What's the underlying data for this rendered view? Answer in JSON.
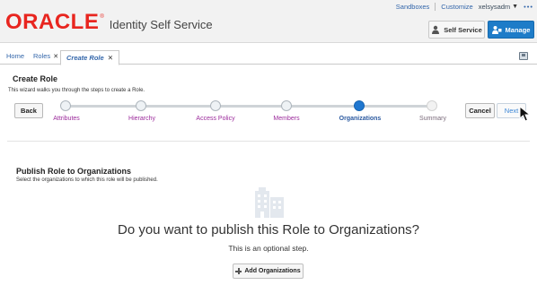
{
  "header": {
    "brand": "ORACLE",
    "product": "Identity Self Service",
    "links": {
      "sandboxes": "Sandboxes",
      "customize": "Customize",
      "user": "xelsysadm"
    },
    "self_service_label": "Self Service",
    "manage_label": "Manage",
    "accent_color": "#1e7cc8",
    "brand_color": "#e8251f"
  },
  "tabs": [
    {
      "label": "Home",
      "closable": false
    },
    {
      "label": "Roles",
      "closable": true
    },
    {
      "label": "Create Role",
      "closable": true,
      "active": true
    }
  ],
  "wizard": {
    "title": "Create Role",
    "description": "This wizard walks you through the steps to create a Role.",
    "back_label": "Back",
    "cancel_label": "Cancel",
    "next_label": "Next",
    "steps": [
      {
        "label": "Attributes",
        "state": "visited"
      },
      {
        "label": "Hierarchy",
        "state": "visited"
      },
      {
        "label": "Access Policy",
        "state": "visited"
      },
      {
        "label": "Members",
        "state": "visited"
      },
      {
        "label": "Organizations",
        "state": "current"
      },
      {
        "label": "Summary",
        "state": "future"
      }
    ]
  },
  "section": {
    "title": "Publish Role to Organizations",
    "description": "Select the organizations to which this role will be published.",
    "question": "Do you want to publish this Role to Organizations?",
    "note": "This is an optional step.",
    "add_label": "Add Organizations"
  }
}
